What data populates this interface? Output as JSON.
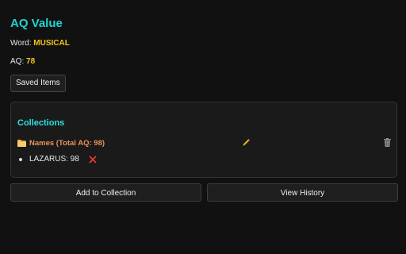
{
  "header": {
    "title": "AQ Value"
  },
  "info": {
    "word_label": "Word:",
    "word_value": "MUSICAL",
    "aq_label": "AQ:",
    "aq_value": "78"
  },
  "toolbar": {
    "saved_items_label": "Saved Items"
  },
  "collections": {
    "heading": "Collections",
    "items": [
      {
        "name": "Names (Total AQ: 98)",
        "icon": "folder-icon",
        "entries": [
          {
            "text": "LAZARUS: 98",
            "remove_icon": "close-icon"
          }
        ]
      }
    ]
  },
  "actions": {
    "add_label": "Add to Collection",
    "history_label": "View History"
  },
  "colors": {
    "background": "#111111",
    "title": "#22d3d3",
    "highlight_value": "#f5c518",
    "collection_name": "#e8935a",
    "remove": "#e53935"
  }
}
